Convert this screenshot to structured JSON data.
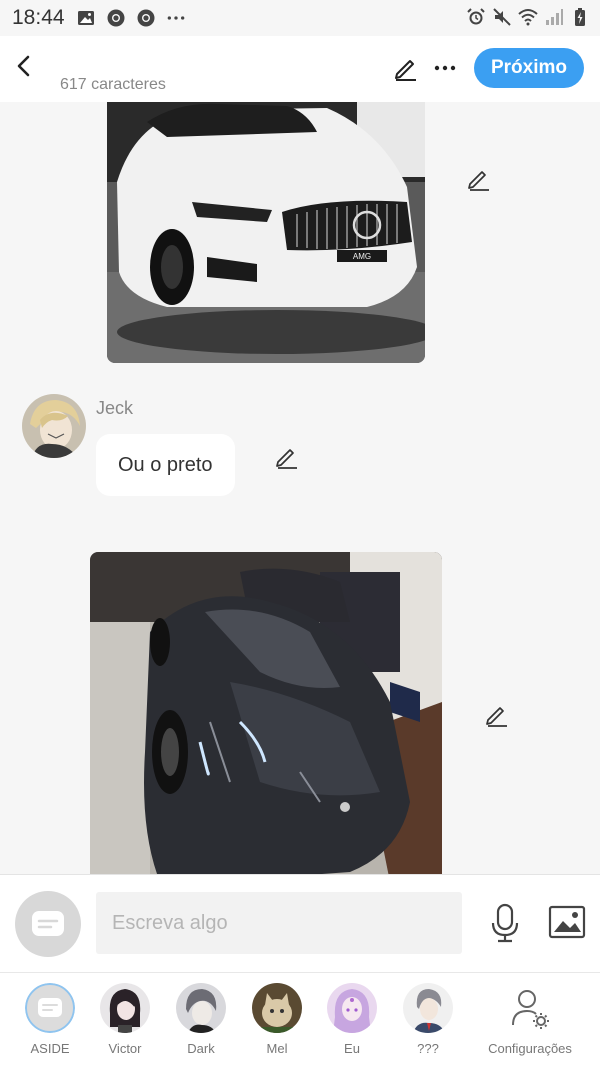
{
  "status_bar": {
    "time": "18:44",
    "left_icons": [
      "image-icon",
      "chrome-icon",
      "chrome-icon",
      "more-dots-icon"
    ],
    "right_icons": [
      "alarm-icon",
      "mute-icon",
      "wifi-icon",
      "signal-icon",
      "battery-charging-icon"
    ]
  },
  "header": {
    "back_icon": "chevron-left-icon",
    "char_count": "617 caracteres",
    "edit_icon": "pencil-icon",
    "more_icon": "more-dots-icon",
    "next_label": "Próximo",
    "accent_color": "#3b9ff2"
  },
  "messages": [
    {
      "type": "image",
      "description_icon": "car-photo-icon",
      "edit_icon": "pencil-icon"
    },
    {
      "type": "text",
      "sender": "Jeck",
      "text": "Ou o preto",
      "edit_icon": "pencil-icon"
    },
    {
      "type": "image",
      "description_icon": "car-photo-icon",
      "edit_icon": "pencil-icon"
    }
  ],
  "input": {
    "placeholder": "Escreva algo",
    "chat_icon": "chat-bubble-icon",
    "mic_icon": "microphone-icon",
    "image_icon": "image-icon"
  },
  "nav": {
    "items": [
      {
        "label": "ASIDE"
      },
      {
        "label": "Victor"
      },
      {
        "label": "Dark"
      },
      {
        "label": "Mel"
      },
      {
        "label": "Eu"
      },
      {
        "label": "???"
      },
      {
        "label": "Configurações"
      }
    ]
  }
}
